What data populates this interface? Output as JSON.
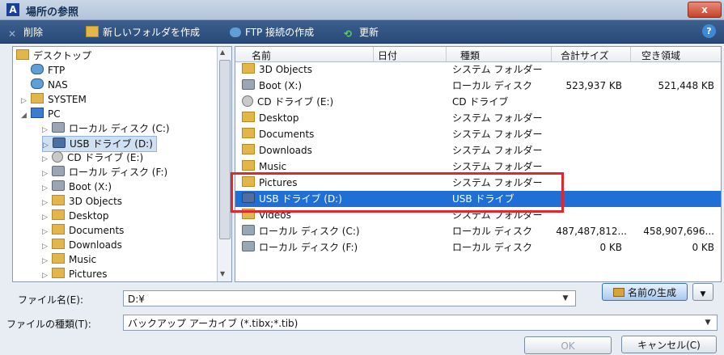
{
  "window": {
    "title": "場所の参照",
    "app_icon": "A",
    "close": "x"
  },
  "toolbar": {
    "delete": "削除",
    "new_folder": "新しいフォルダを作成",
    "ftp": "FTP 接続の作成",
    "refresh": "更新",
    "help": "?"
  },
  "tree": {
    "items": [
      {
        "label": "デスクトップ",
        "icon": "folder-icon"
      },
      {
        "label": "FTP",
        "icon": "network-icon"
      },
      {
        "label": "NAS",
        "icon": "network-icon"
      },
      {
        "label": "SYSTEM",
        "icon": "folder-icon"
      },
      {
        "label": "PC",
        "icon": "computer-icon"
      },
      {
        "label": "ローカル ディスク (C:)",
        "icon": "drive-icon"
      },
      {
        "label": "USB ドライブ (D:)",
        "icon": "usb-drive-icon"
      },
      {
        "label": "CD ドライブ (E:)",
        "icon": "cd-drive-icon"
      },
      {
        "label": "ローカル ディスク (F:)",
        "icon": "drive-icon"
      },
      {
        "label": "Boot (X:)",
        "icon": "drive-icon"
      },
      {
        "label": "3D Objects",
        "icon": "folder-icon"
      },
      {
        "label": "Desktop",
        "icon": "folder-icon"
      },
      {
        "label": "Documents",
        "icon": "folder-icon"
      },
      {
        "label": "Downloads",
        "icon": "folder-icon"
      },
      {
        "label": "Music",
        "icon": "folder-icon"
      },
      {
        "label": "Pictures",
        "icon": "folder-icon"
      }
    ]
  },
  "list": {
    "columns": [
      "名前",
      "日付",
      "種類",
      "合計サイズ",
      "空き領域"
    ],
    "rows": [
      {
        "name": "3D Objects",
        "date": "",
        "type": "システム フォルダー",
        "total": "",
        "free": ""
      },
      {
        "name": "Boot (X:)",
        "date": "",
        "type": "ローカル ディスク",
        "total": "523,937 KB",
        "free": "521,448 KB"
      },
      {
        "name": "CD ドライブ (E:)",
        "date": "",
        "type": "CD ドライブ",
        "total": "",
        "free": ""
      },
      {
        "name": "Desktop",
        "date": "",
        "type": "システム フォルダー",
        "total": "",
        "free": ""
      },
      {
        "name": "Documents",
        "date": "",
        "type": "システム フォルダー",
        "total": "",
        "free": ""
      },
      {
        "name": "Downloads",
        "date": "",
        "type": "システム フォルダー",
        "total": "",
        "free": ""
      },
      {
        "name": "Music",
        "date": "",
        "type": "システム フォルダー",
        "total": "",
        "free": ""
      },
      {
        "name": "Pictures",
        "date": "",
        "type": "システム フォルダー",
        "total": "",
        "free": ""
      },
      {
        "name": "USB ドライブ (D:)",
        "date": "",
        "type": "USB ドライブ",
        "total": "",
        "free": ""
      },
      {
        "name": "Videos",
        "date": "",
        "type": "システム フォルダー",
        "total": "",
        "free": ""
      },
      {
        "name": "ローカル ディスク (C:)",
        "date": "",
        "type": "ローカル ディスク",
        "total": "487,487,812...",
        "free": "458,907,696..."
      },
      {
        "name": "ローカル ディスク (F:)",
        "date": "",
        "type": "ローカル ディスク",
        "total": "0 KB",
        "free": "0 KB"
      }
    ]
  },
  "footer": {
    "filename_label": "ファイル名(E):",
    "filename_value": "D:¥",
    "filetype_label": "ファイルの種類(T):",
    "filetype_value": "バックアップ アーカイブ (*.tibx;*.tib)",
    "generate_name": "名前の生成",
    "ok": "OK",
    "cancel": "キャンセル(C)"
  },
  "colors": {
    "accent": "#1f6fd6",
    "highlight_box": "#e2262d",
    "toolbar": "#2f5283"
  }
}
